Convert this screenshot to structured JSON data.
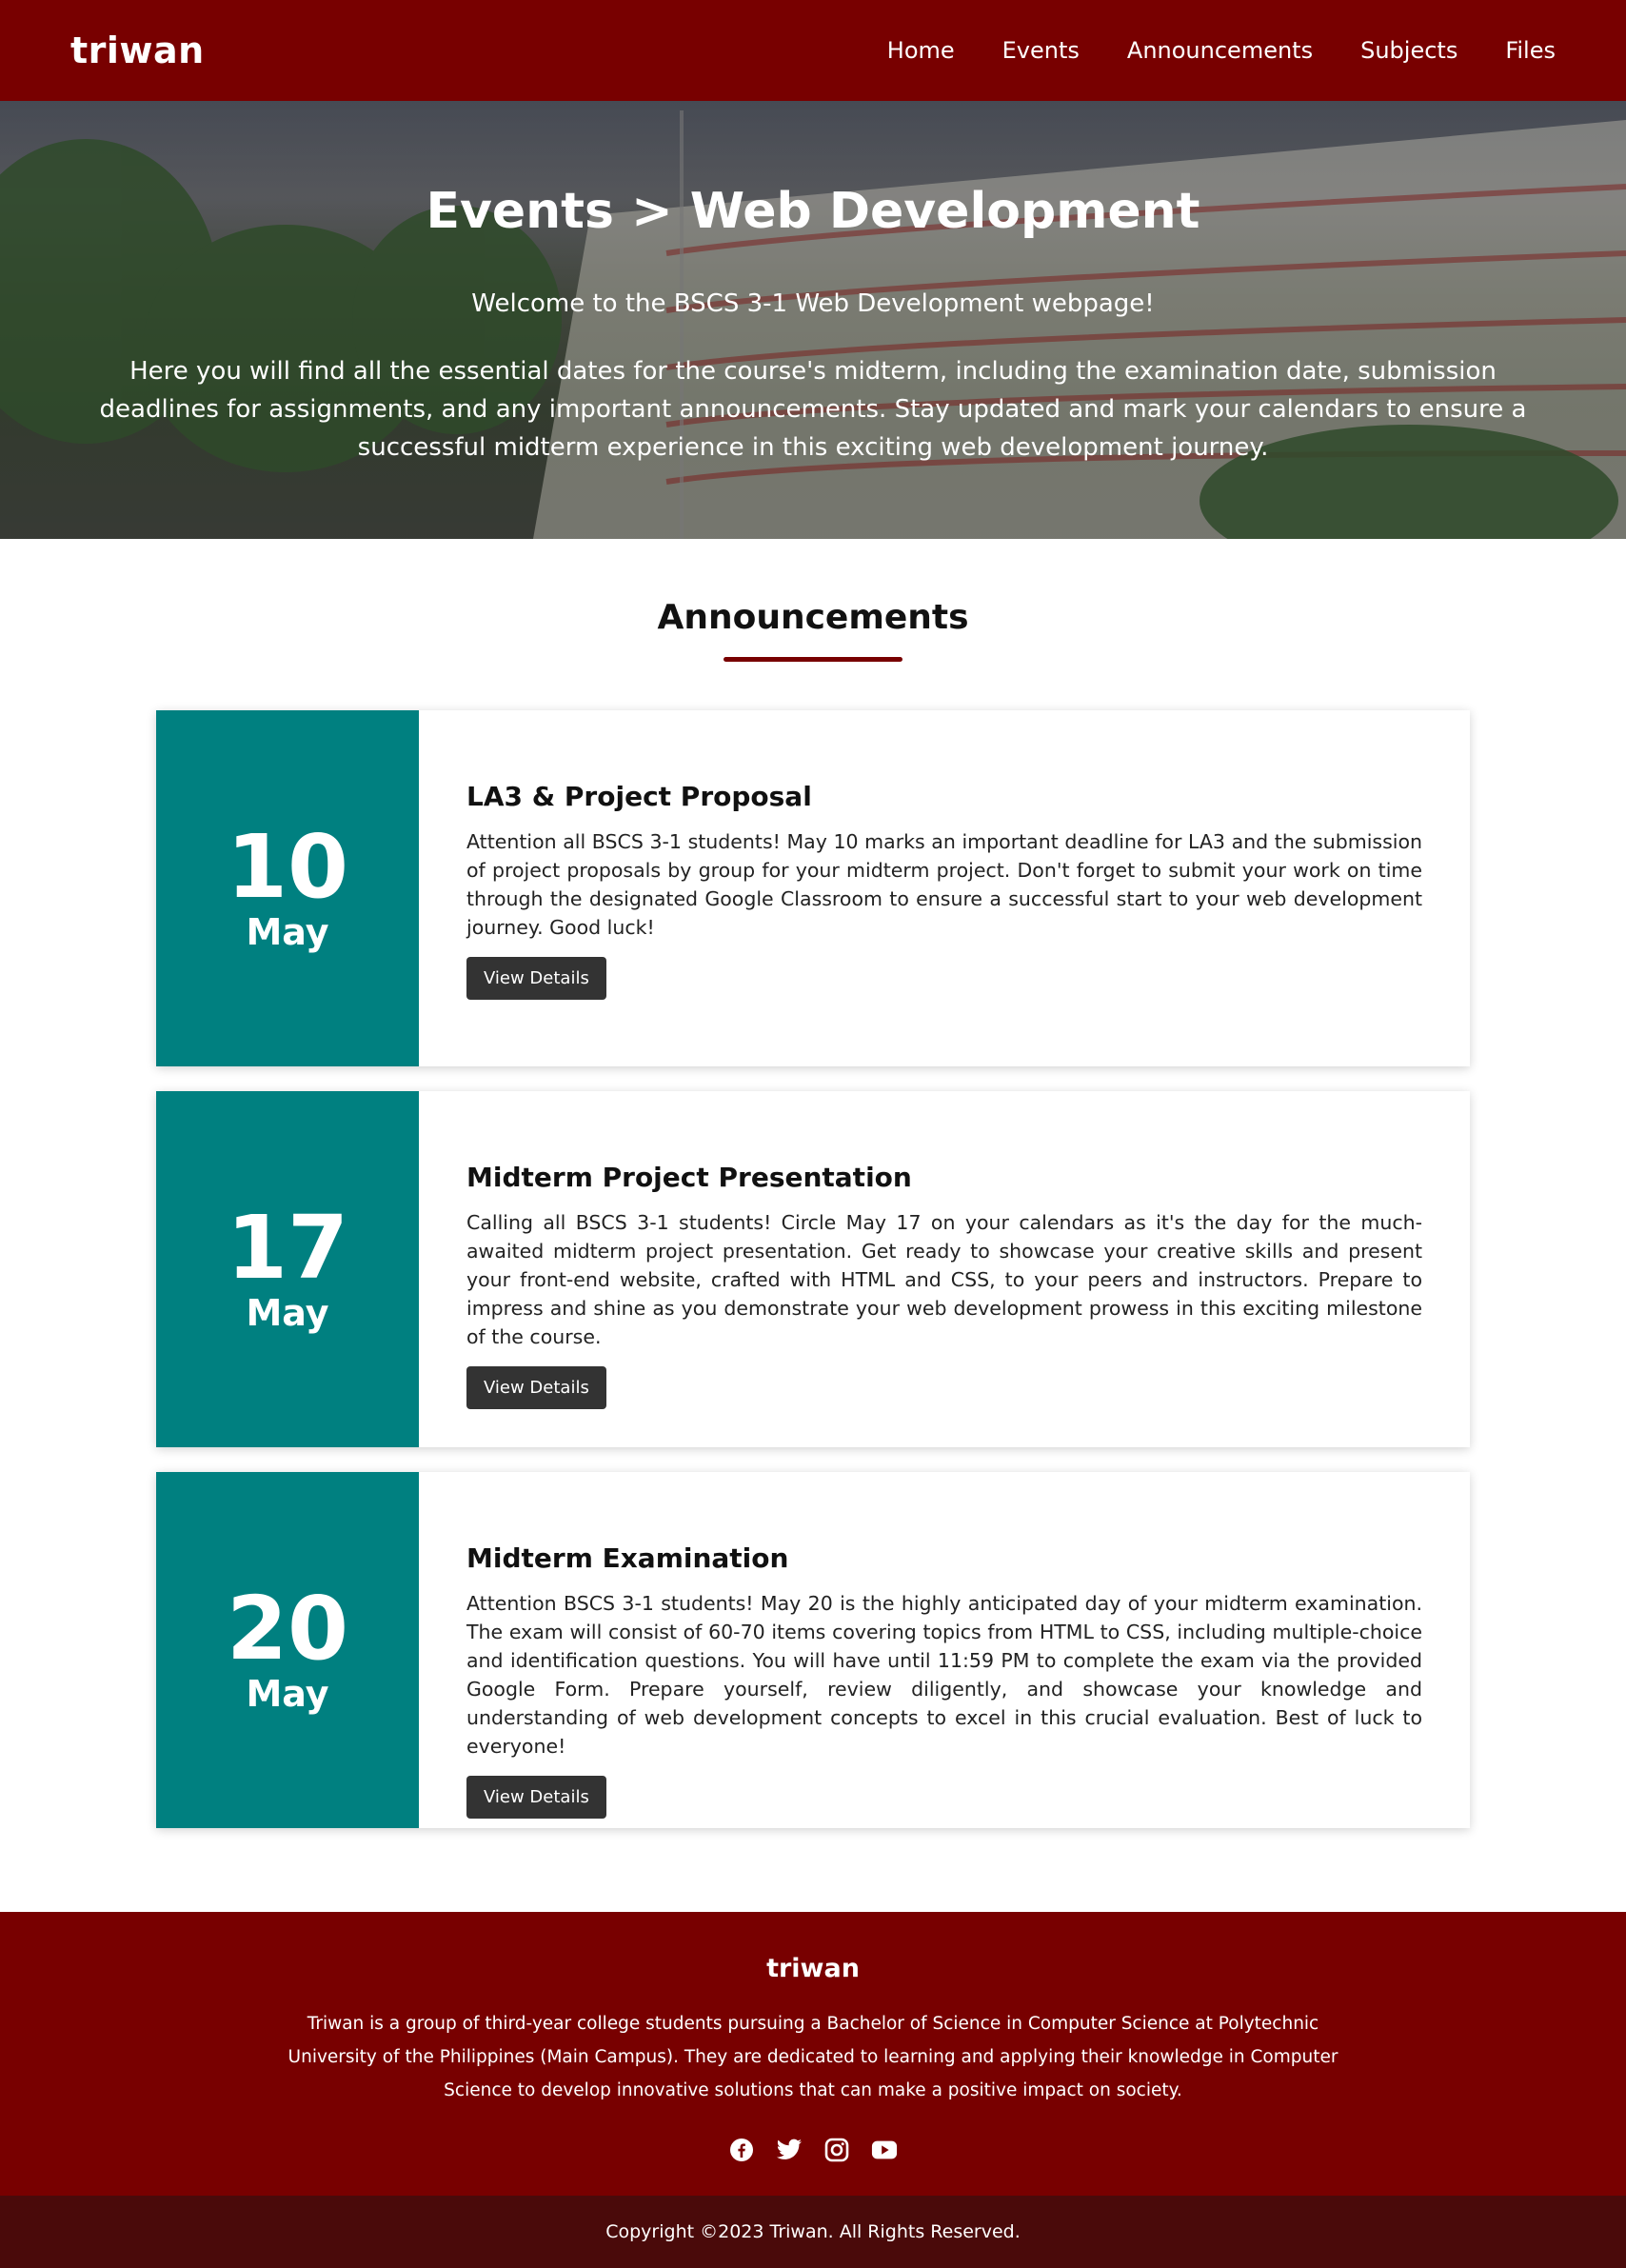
{
  "nav": {
    "brand": "triwan",
    "links": [
      "Home",
      "Events",
      "Announcements",
      "Subjects",
      "Files"
    ]
  },
  "hero": {
    "title": "Events > Web Development",
    "welcome": "Welcome to the BSCS 3-1 Web Development webpage!",
    "description": "Here you will find all the essential dates for the course's midterm, including the examination date, submission deadlines for assignments, and any important announcements. Stay updated and mark your calendars to ensure a successful midterm experience in this exciting web development journey."
  },
  "announcements": {
    "heading": "Announcements",
    "items": [
      {
        "day": "10",
        "month": "May",
        "title": "LA3 & Project Proposal",
        "text": "Attention all BSCS 3-1 students! May 10 marks an important deadline for LA3 and the submission of project proposals by group for your midterm project. Don't forget to submit your work on time through the designated Google Classroom to ensure a successful start to your web development journey. Good luck!",
        "button": "View Details"
      },
      {
        "day": "17",
        "month": "May",
        "title": "Midterm Project Presentation",
        "text": "Calling all BSCS 3-1 students! Circle May 17 on your calendars as it's the day for the much-awaited midterm project presentation. Get ready to showcase your creative skills and present your front-end website, crafted with HTML and CSS, to your peers and instructors. Prepare to impress and shine as you demonstrate your web development prowess in this exciting milestone of the course.",
        "button": "View Details"
      },
      {
        "day": "20",
        "month": "May",
        "title": "Midterm Examination",
        "text": "Attention BSCS 3-1 students! May 20 is the highly anticipated day of your midterm examination. The exam will consist of 60-70 items covering topics from HTML to CSS, including multiple-choice and identification questions. You will have until 11:59 PM to complete the exam via the provided Google Form. Prepare yourself, review diligently, and showcase your knowledge and understanding of web development concepts to excel in this crucial evaluation. Best of luck to everyone!",
        "button": "View Details"
      }
    ]
  },
  "footer": {
    "brand": "triwan",
    "text": "Triwan is a group of third-year college students pursuing a Bachelor of Science in Computer Science at Polytechnic University of the Philippines (Main Campus). They are dedicated to learning and applying their knowledge in Computer Science to develop innovative solutions that can make a positive impact on society.",
    "socials": [
      "facebook-icon",
      "twitter-icon",
      "instagram-icon",
      "youtube-icon"
    ],
    "copyright": "Copyright ©2023 Triwan. All Rights Reserved."
  },
  "colors": {
    "primary": "#780000",
    "accent": "#008080",
    "button": "#333333",
    "footer_bottom": "#4a0a0a"
  }
}
